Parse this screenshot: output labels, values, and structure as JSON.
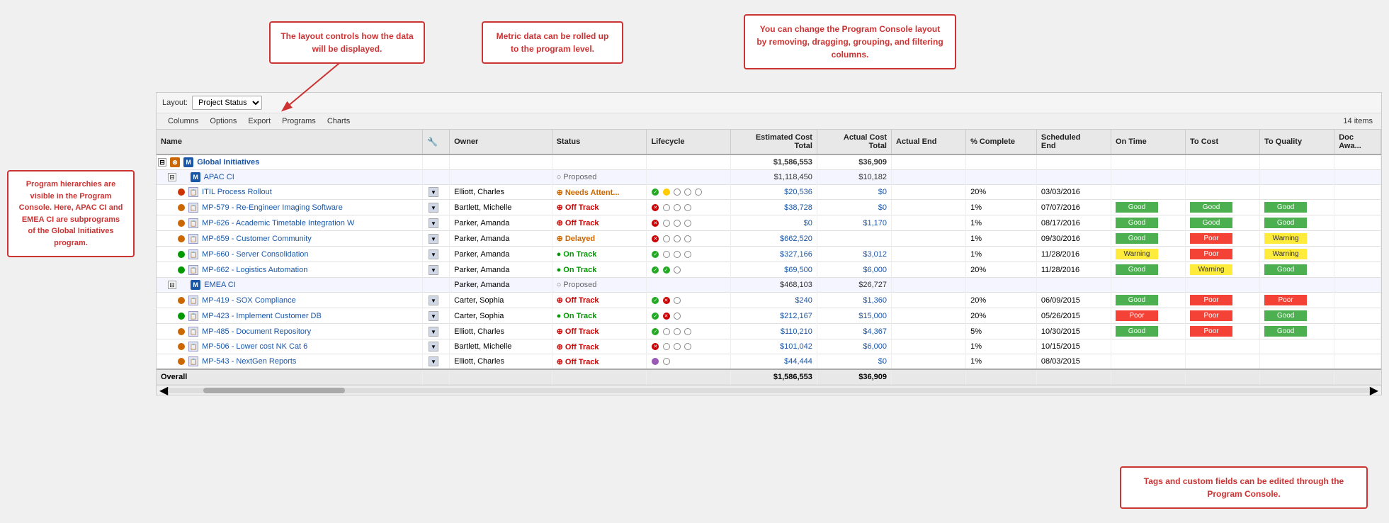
{
  "toolbar": {
    "layout_label": "Layout:",
    "layout_value": "Project Status"
  },
  "menu": {
    "items": [
      "Columns",
      "Options",
      "Export",
      "Programs",
      "Charts"
    ]
  },
  "table": {
    "item_count": "14 items",
    "headers": [
      "Name",
      "",
      "Owner",
      "Status",
      "Lifecycle",
      "Estimated Cost Total",
      "Actual Cost Total",
      "Actual End",
      "% Complete",
      "Scheduled End",
      "On Time",
      "To Cost",
      "To Quality",
      "Doc Awa..."
    ],
    "rows": [
      {
        "indent": 0,
        "type": "program",
        "expand": "⊟",
        "name": "Global Initiatives",
        "owner": "",
        "status": "",
        "lifecycle": "",
        "est_cost": "$1,586,553",
        "act_cost": "$36,909",
        "act_end": "",
        "pct": "",
        "sched_end": "",
        "ontime": "",
        "tocost": "",
        "toqual": "",
        "doc": ""
      },
      {
        "indent": 1,
        "type": "program",
        "expand": "⊟",
        "name": "APAC CI",
        "owner": "",
        "status": "○ Proposed",
        "lifecycle": "",
        "est_cost": "$1,118,450",
        "act_cost": "$10,182",
        "act_end": "",
        "pct": "",
        "sched_end": "",
        "ontime": "",
        "tocost": "",
        "toqual": "",
        "doc": ""
      },
      {
        "indent": 2,
        "type": "project",
        "name": "ITIL Process Rollout",
        "owner": "Elliott, Charles",
        "status": "⊕ Needs Attent...",
        "lifecycle": "circles5",
        "est_cost": "$20,536",
        "act_cost": "$0",
        "act_end": "",
        "pct": "20%",
        "sched_end": "03/03/2016",
        "ontime": "",
        "tocost": "",
        "toqual": "",
        "doc": ""
      },
      {
        "indent": 2,
        "type": "project",
        "name": "MP-579 - Re-Engineer Imaging Software",
        "owner": "Bartlett, Michelle",
        "status": "⊕ Off Track",
        "lifecycle": "circles4",
        "est_cost": "$38,728",
        "act_cost": "$0",
        "act_end": "",
        "pct": "1%",
        "sched_end": "07/07/2016",
        "ontime": "Good",
        "tocost": "Good",
        "toqual": "Good",
        "doc": ""
      },
      {
        "indent": 2,
        "type": "project",
        "name": "MP-626 - Academic Timetable Integration W",
        "owner": "Parker, Amanda",
        "status": "⊕ Off Track",
        "lifecycle": "circles4",
        "est_cost": "$0",
        "act_cost": "$1,170",
        "act_end": "",
        "pct": "1%",
        "sched_end": "08/17/2016",
        "ontime": "Good",
        "tocost": "Good",
        "toqual": "Good",
        "doc": ""
      },
      {
        "indent": 2,
        "type": "project",
        "name": "MP-659 - Customer Community",
        "owner": "Parker, Amanda",
        "status": "⊕ Delayed",
        "lifecycle": "circles4",
        "est_cost": "$662,520",
        "act_cost": "",
        "act_end": "",
        "pct": "1%",
        "sched_end": "09/30/2016",
        "ontime": "Good",
        "tocost": "Poor",
        "toqual": "Warning",
        "doc": ""
      },
      {
        "indent": 2,
        "type": "project",
        "name": "MP-660 - Server Consolidation",
        "owner": "Parker, Amanda",
        "status": "● On Track",
        "lifecycle": "circles4",
        "est_cost": "$327,166",
        "act_cost": "$3,012",
        "act_end": "",
        "pct": "1%",
        "sched_end": "11/28/2016",
        "ontime": "Warning",
        "tocost": "Poor",
        "toqual": "Warning",
        "doc": ""
      },
      {
        "indent": 2,
        "type": "project",
        "name": "MP-662 - Logistics Automation",
        "owner": "Parker, Amanda",
        "status": "● On Track",
        "lifecycle": "circles3",
        "est_cost": "$69,500",
        "act_cost": "$6,000",
        "act_end": "",
        "pct": "20%",
        "sched_end": "11/28/2016",
        "ontime": "Good",
        "tocost": "Warning",
        "toqual": "Good",
        "doc": ""
      },
      {
        "indent": 1,
        "type": "program",
        "expand": "⊟",
        "name": "EMEA CI",
        "owner": "Parker, Amanda",
        "status": "○ Proposed",
        "lifecycle": "",
        "est_cost": "$468,103",
        "act_cost": "$26,727",
        "act_end": "",
        "pct": "",
        "sched_end": "",
        "ontime": "",
        "tocost": "",
        "toqual": "",
        "doc": ""
      },
      {
        "indent": 2,
        "type": "project",
        "name": "MP-419 - SOX Compliance",
        "owner": "Carter, Sophia",
        "status": "⊕ Off Track",
        "lifecycle": "circles3",
        "est_cost": "$240",
        "act_cost": "$1,360",
        "act_end": "",
        "pct": "20%",
        "sched_end": "06/09/2015",
        "ontime": "Good",
        "tocost": "Poor",
        "toqual": "Poor",
        "doc": ""
      },
      {
        "indent": 2,
        "type": "project",
        "name": "MP-423 - Implement Customer DB",
        "owner": "Carter, Sophia",
        "status": "● On Track",
        "lifecycle": "circles3",
        "est_cost": "$212,167",
        "act_cost": "$15,000",
        "act_end": "",
        "pct": "20%",
        "sched_end": "05/26/2015",
        "ontime": "Poor",
        "tocost": "Poor",
        "toqual": "Good",
        "doc": ""
      },
      {
        "indent": 2,
        "type": "project",
        "name": "MP-485 - Document Repository",
        "owner": "Elliott, Charles",
        "status": "⊕ Off Track",
        "lifecycle": "circles4",
        "est_cost": "$110,210",
        "act_cost": "$4,367",
        "act_end": "",
        "pct": "5%",
        "sched_end": "10/30/2015",
        "ontime": "Good",
        "tocost": "Poor",
        "toqual": "Good",
        "doc": ""
      },
      {
        "indent": 2,
        "type": "project",
        "name": "MP-506 - Lower cost NK Cat 6",
        "owner": "Bartlett, Michelle",
        "status": "⊕ Off Track",
        "lifecycle": "circles4",
        "est_cost": "$101,042",
        "act_cost": "$6,000",
        "act_end": "",
        "pct": "1%",
        "sched_end": "10/15/2015",
        "ontime": "",
        "tocost": "",
        "toqual": "",
        "doc": ""
      },
      {
        "indent": 2,
        "type": "project",
        "name": "MP-543 - NextGen Reports",
        "owner": "Elliott, Charles",
        "status": "⊕ Off Track",
        "lifecycle": "circles2",
        "est_cost": "$44,444",
        "act_cost": "$0",
        "act_end": "",
        "pct": "1%",
        "sched_end": "08/03/2015",
        "ontime": "",
        "tocost": "",
        "toqual": "",
        "doc": ""
      }
    ],
    "overall": {
      "label": "Overall",
      "est_cost": "$1,586,553",
      "act_cost": "$36,909"
    }
  },
  "callouts": {
    "layout": {
      "text": "The layout controls how\nthe data will be displayed."
    },
    "metric": {
      "text": "Metric data can be rolled\nup to the program level."
    },
    "program_console": {
      "text": "You can change the Program Console\nlayout by removing, dragging,\ngrouping, and filtering columns."
    },
    "hierarchy": {
      "text": "Program hierarchies are\nvisible in the Program\nConsole. Here, APAC CI\nand EMEA CI are\nsubprograms of the\nGlobal Initiatives program."
    },
    "tags": {
      "text": "Tags and custom fields can be\nedited through the Program Console."
    }
  }
}
